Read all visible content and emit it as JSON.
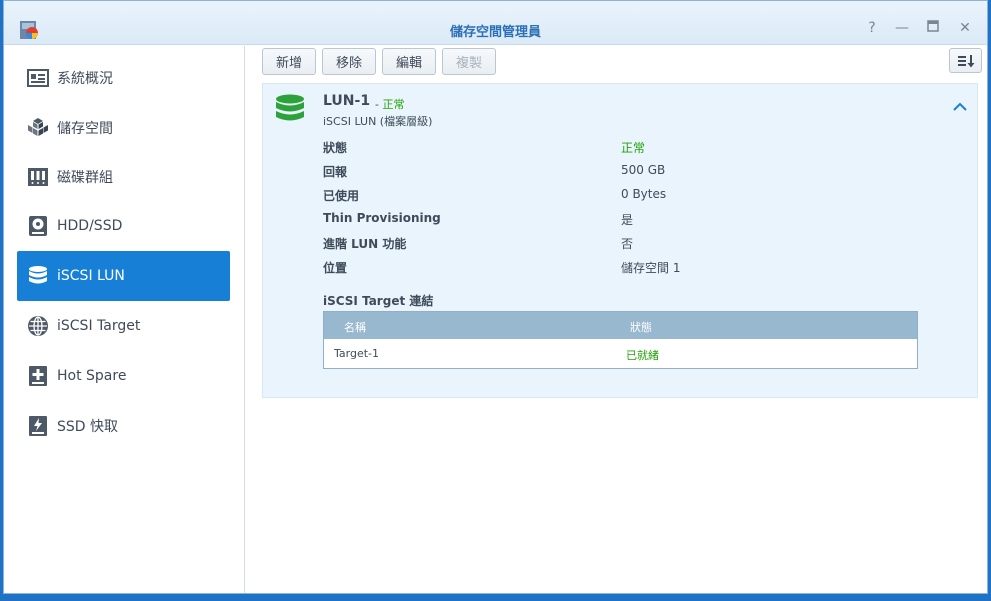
{
  "window": {
    "title": "儲存空間管理員"
  },
  "sidebar": {
    "items": [
      {
        "label": "系統概況",
        "icon": "overview-icon"
      },
      {
        "label": "儲存空間",
        "icon": "storage-cubes-icon"
      },
      {
        "label": "磁碟群組",
        "icon": "disk-group-icon"
      },
      {
        "label": "HDD/SSD",
        "icon": "disk-icon"
      },
      {
        "label": "iSCSI LUN",
        "icon": "database-icon"
      },
      {
        "label": "iSCSI Target",
        "icon": "globe-icon"
      },
      {
        "label": "Hot Spare",
        "icon": "plus-disk-icon"
      },
      {
        "label": "SSD 快取",
        "icon": "bolt-disk-icon"
      }
    ],
    "active": "iSCSI LUN"
  },
  "toolbar": {
    "add": "新增",
    "remove": "移除",
    "edit": "編輯",
    "clone": "複製"
  },
  "lun": {
    "name": "LUN-1",
    "separator": " - ",
    "status": "正常",
    "subtitle": "iSCSI LUN (檔案層級)",
    "properties": [
      {
        "label": "狀態",
        "value": "正常"
      },
      {
        "label": "回報",
        "value": "500 GB"
      },
      {
        "label": "已使用",
        "value": "0 Bytes"
      },
      {
        "label": "Thin Provisioning",
        "value": "是"
      },
      {
        "label": "進階 LUN 功能",
        "value": "否"
      },
      {
        "label": "位置",
        "value": "儲存空間 1"
      }
    ],
    "target_section_title": "iSCSI Target 連結",
    "target_table": {
      "headers": [
        "名稱",
        "狀態"
      ],
      "rows": [
        {
          "name": "Target-1",
          "status": "已就緒"
        }
      ]
    }
  },
  "colors": {
    "accent": "#1780d6",
    "ok": "#23a20a",
    "panel": "#e9f4fc"
  }
}
